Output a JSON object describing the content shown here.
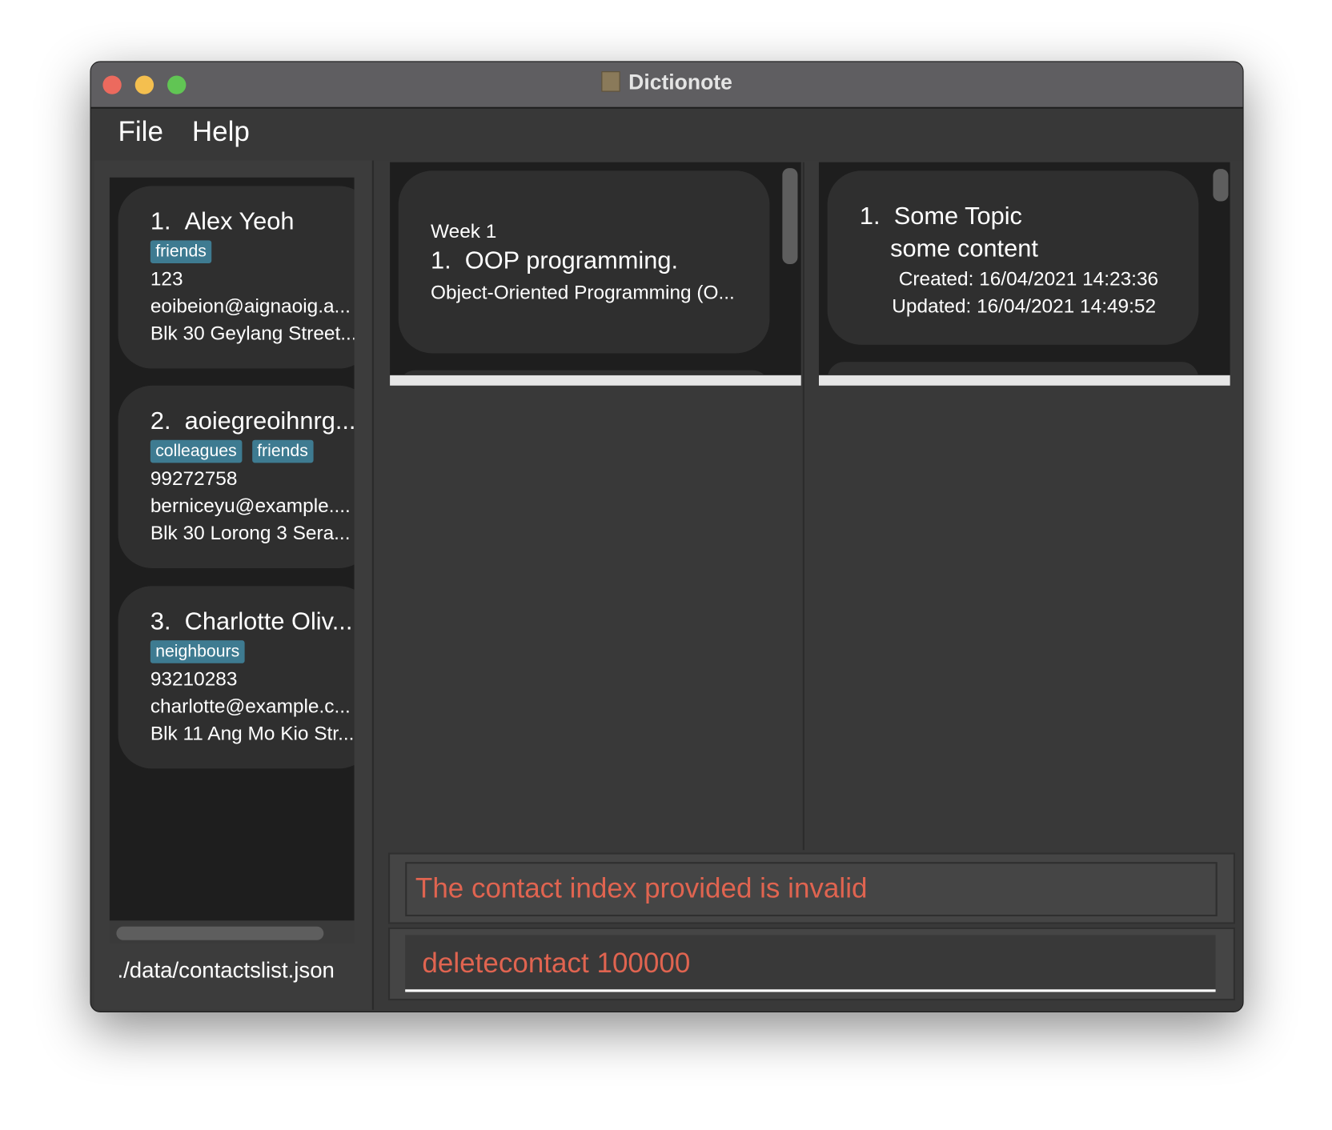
{
  "window": {
    "title": "Dictionote",
    "traffic_lights": {
      "close": "#ec6a5e",
      "minimize": "#f4bf4f",
      "maximize": "#61c554"
    }
  },
  "menu": {
    "items": [
      "File",
      "Help"
    ]
  },
  "contacts": [
    {
      "index": "1.",
      "name": "Alex Yeoh",
      "tags": [
        "friends"
      ],
      "phone": "123",
      "email": "eoibeion@aignaoig.a...",
      "address": "Blk 30 Geylang Street..."
    },
    {
      "index": "2.",
      "name": "aoiegreoihnrg...",
      "tags": [
        "colleagues",
        "friends"
      ],
      "phone": "99272758",
      "email": "berniceyu@example....",
      "address": "Blk 30 Lorong 3 Sera..."
    },
    {
      "index": "3.",
      "name": "Charlotte Oliv...",
      "tags": [
        "neighbours"
      ],
      "phone": "93210283",
      "email": "charlotte@example.c...",
      "address": "Blk 11 Ang Mo Kio Str..."
    }
  ],
  "contacts_file_path": "./data/contactslist.json",
  "notes": [
    {
      "week": "Week 1",
      "index": "1.",
      "title": "OOP programming.",
      "content": "Object-Oriented Programming (O..."
    }
  ],
  "dictionary": [
    {
      "index": "1.",
      "topic": "Some Topic",
      "content": "some content",
      "created": "Created: 16/04/2021 14:23:36",
      "updated": "Updated: 16/04/2021 14:49:52"
    }
  ],
  "result_message": "The contact index provided is invalid",
  "command_input": "deletecontact 100000",
  "colors": {
    "tag": "#3e7b91",
    "error_text": "#e06450"
  }
}
